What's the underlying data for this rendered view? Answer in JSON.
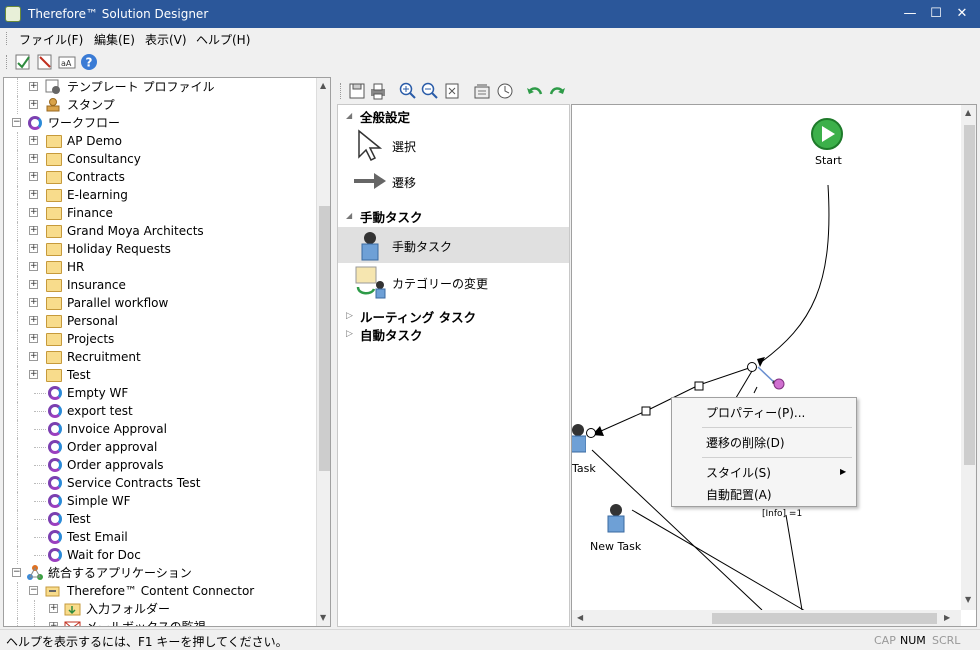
{
  "window": {
    "title": "Therefore™ Solution Designer",
    "minimize": "—",
    "maximize": "☐",
    "close": "✕"
  },
  "menu": [
    "ファイル(F)",
    "編集(E)",
    "表示(V)",
    "ヘルプ(H)"
  ],
  "tree": {
    "top": [
      {
        "label": "テンプレート プロファイル",
        "icon": "template-profile-icon"
      },
      {
        "label": "スタンプ",
        "icon": "stamp-icon"
      }
    ],
    "workflow_label": "ワークフロー",
    "folders": [
      "AP Demo",
      "Consultancy",
      "Contracts",
      "E-learning",
      "Finance",
      "Grand Moya Architects",
      "Holiday Requests",
      "HR",
      "Insurance",
      "Parallel workflow",
      "Personal",
      "Projects",
      "Recruitment",
      "Test"
    ],
    "workflows": [
      "Empty WF",
      "export test",
      "Invoice Approval",
      "Order approval",
      "Order approvals",
      "Service Contracts Test",
      "Simple WF",
      "Test",
      "Test Email",
      "Wait for Doc"
    ],
    "integrations_label": "統合するアプリケーション",
    "connector_label": "Therefore™ Content Connector",
    "input_folder_label": "入力フォルダー",
    "mailbox_label": "メールボックスの監視"
  },
  "palette": {
    "sections": [
      {
        "label": "全般設定",
        "items": [
          "選択",
          "遷移"
        ]
      },
      {
        "label": "手動タスク",
        "items": [
          "手動タスク",
          "カテゴリーの変更"
        ]
      },
      {
        "label": "ルーティング タスク"
      },
      {
        "label": "自動タスク"
      }
    ]
  },
  "canvas": {
    "start": "Start",
    "task1": "Task",
    "task2": "New Task",
    "info": "[Info] =1"
  },
  "context_menu": [
    "プロパティー(P)...",
    "遷移の削除(D)",
    "スタイル(S)",
    "自動配置(A)"
  ],
  "status": {
    "help": "ヘルプを表示するには、F1 キーを押してください。",
    "cap": "CAP",
    "num": "NUM",
    "scrl": "SCRL"
  }
}
